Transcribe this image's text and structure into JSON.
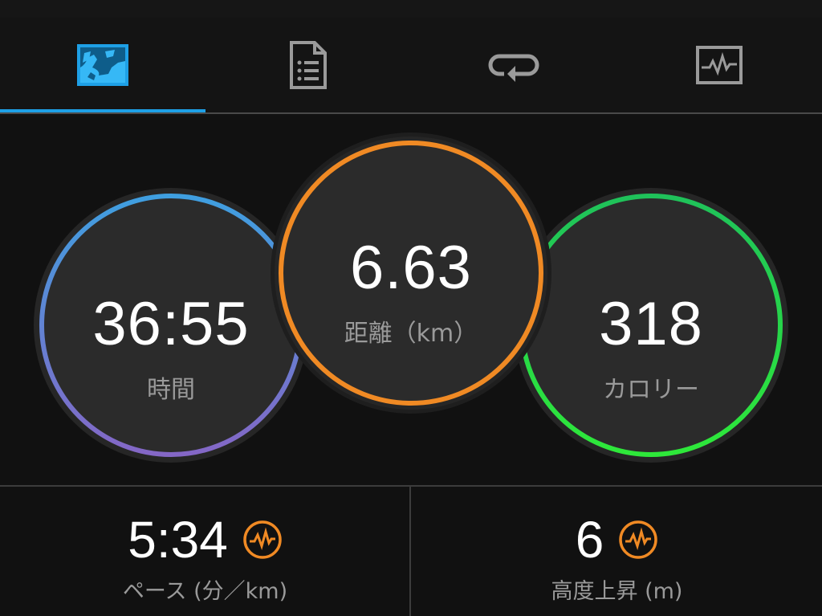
{
  "tabs": [
    {
      "icon": "map-icon",
      "active": true
    },
    {
      "icon": "document-list-icon",
      "active": false
    },
    {
      "icon": "laps-loop-icon",
      "active": false
    },
    {
      "icon": "activity-graph-icon",
      "active": false
    }
  ],
  "colors": {
    "accent": "#1ea0e6",
    "time_ring_start": "#3f9fe0",
    "time_ring_end": "#8467c6",
    "distance_ring": "#f08a24",
    "calorie_ring_start": "#1fc25a",
    "calorie_ring_end": "#2ee83a",
    "badge": "#f08a24"
  },
  "circles": {
    "time": {
      "value": "36:55",
      "label": "時間"
    },
    "distance": {
      "value": "6.63",
      "label": "距離（km）"
    },
    "calories": {
      "value": "318",
      "label": "カロリー"
    }
  },
  "metrics": [
    {
      "value": "5:34",
      "label": "ペース (分／km)",
      "badge_icon": "heart-rate-icon"
    },
    {
      "value": "6",
      "label": "高度上昇 (m)",
      "badge_icon": "heart-rate-icon"
    }
  ]
}
